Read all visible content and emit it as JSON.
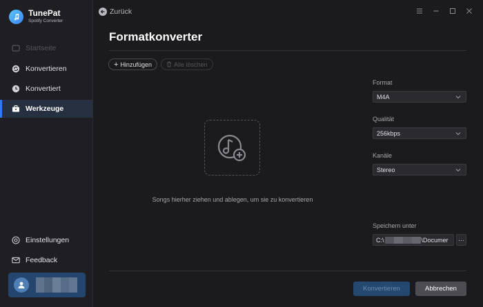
{
  "app": {
    "name": "TunePat",
    "subtitle": "Spotify Converter"
  },
  "sidebar": {
    "items": [
      {
        "label": "Startseite",
        "icon": "home-icon",
        "state": "disabled"
      },
      {
        "label": "Konvertieren",
        "icon": "convert-icon",
        "state": "normal"
      },
      {
        "label": "Konvertiert",
        "icon": "clock-icon",
        "state": "normal"
      },
      {
        "label": "Werkzeuge",
        "icon": "toolbox-icon",
        "state": "active"
      },
      {
        "label": "Einstellungen",
        "icon": "gear-icon",
        "state": "normal"
      },
      {
        "label": "Feedback",
        "icon": "mail-icon",
        "state": "normal"
      }
    ]
  },
  "topbar": {
    "back_label": "Zurück"
  },
  "main": {
    "title": "Formatkonverter",
    "add_label": "Hinzufügen",
    "clear_label": "Alle löschen",
    "drop_hint": "Songs hierher ziehen und ablegen, um sie zu konvertieren"
  },
  "settings": {
    "format": {
      "label": "Format",
      "value": "M4A"
    },
    "quality": {
      "label": "Qualität",
      "value": "256kbps"
    },
    "channels": {
      "label": "Kanäle",
      "value": "Stereo"
    },
    "save_to": {
      "label": "Speichern unter",
      "path_prefix": "C:\\",
      "path_suffix": "\\Documer",
      "browse_label": "···"
    }
  },
  "footer": {
    "convert_label": "Konvertieren",
    "cancel_label": "Abbrechen"
  },
  "colors": {
    "accent": "#2b7df0",
    "active_bg": "#263040",
    "convert_bg": "#24486f",
    "cancel_bg": "#4c4c52"
  }
}
